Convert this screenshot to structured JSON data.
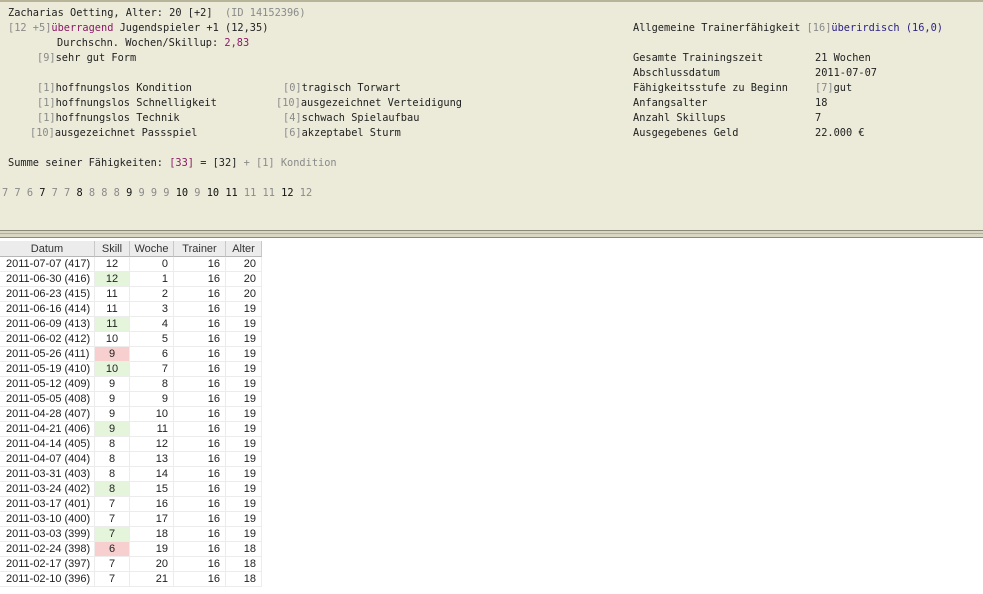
{
  "player": {
    "name_line": "Zacharias Oetting, Alter: 20 [+2]",
    "id_label": "(ID 14152396)",
    "rating_prefix": "[12 +5]",
    "rating_word": "überragend",
    "rating_role": "Jugendspieler +1 (12,35)",
    "avg_label": "Durchschn. Wochen/Skillup:",
    "avg_value": "2,83",
    "form_code": "[9]",
    "form_text": "sehr gut Form"
  },
  "skills": [
    {
      "code": "[1]",
      "text": "hoffnungslos Kondition"
    },
    {
      "code": "[1]",
      "text": "hoffnungslos Schnelligkeit"
    },
    {
      "code": "[1]",
      "text": "hoffnungslos Technik"
    },
    {
      "code": "[10]",
      "text": "ausgezeichnet Passspiel"
    },
    {
      "code": "[0]",
      "text": "tragisch Torwart"
    },
    {
      "code": "[10]",
      "text": "ausgezeichnet Verteidigung"
    },
    {
      "code": "[4]",
      "text": "schwach Spielaufbau"
    },
    {
      "code": "[6]",
      "text": "akzeptabel Sturm"
    }
  ],
  "trainer": {
    "label": "Allgemeine Trainerfähigkeit",
    "code": "[16]",
    "word": "überirdisch",
    "value": "(16,0)"
  },
  "stats": [
    {
      "label": "Gesamte Trainingszeit",
      "value": "21 Wochen"
    },
    {
      "label": "Abschlussdatum",
      "value": "2011-07-07"
    },
    {
      "label": "Fähigkeitsstufe zu Beginn",
      "code": "[7]",
      "value": "gut"
    },
    {
      "label": "Anfangsalter",
      "value": "18"
    },
    {
      "label": "Anzahl Skillups",
      "value": "7"
    },
    {
      "label": "Ausgegebenes Geld",
      "value": "22.000 €"
    }
  ],
  "sum": {
    "label": "Summe seiner Fähigkeiten:",
    "total": "[33]",
    "eq": "=",
    "base": "[32]",
    "plus": "+",
    "extra": "[1] Kondition"
  },
  "progression": [
    {
      "v": "7",
      "dark": false
    },
    {
      "v": "7",
      "dark": false
    },
    {
      "v": "6",
      "dark": false
    },
    {
      "v": "7",
      "dark": true
    },
    {
      "v": "7",
      "dark": false
    },
    {
      "v": "7",
      "dark": false
    },
    {
      "v": "8",
      "dark": true
    },
    {
      "v": "8",
      "dark": false
    },
    {
      "v": "8",
      "dark": false
    },
    {
      "v": "8",
      "dark": false
    },
    {
      "v": "9",
      "dark": true
    },
    {
      "v": "9",
      "dark": false
    },
    {
      "v": "9",
      "dark": false
    },
    {
      "v": "9",
      "dark": false
    },
    {
      "v": "10",
      "dark": true
    },
    {
      "v": "9",
      "dark": false
    },
    {
      "v": "10",
      "dark": true
    },
    {
      "v": "11",
      "dark": true
    },
    {
      "v": "11",
      "dark": false
    },
    {
      "v": "11",
      "dark": false
    },
    {
      "v": "12",
      "dark": true
    },
    {
      "v": "12",
      "dark": false
    }
  ],
  "table": {
    "columns": [
      "Datum",
      "Skill",
      "Woche",
      "Trainer",
      "Alter"
    ],
    "rows": [
      {
        "date": "2011-07-07 (417)",
        "skill": "12",
        "woche": "0",
        "trainer": "16",
        "alter": "20",
        "mark": ""
      },
      {
        "date": "2011-06-30 (416)",
        "skill": "12",
        "woche": "1",
        "trainer": "16",
        "alter": "20",
        "mark": "up"
      },
      {
        "date": "2011-06-23 (415)",
        "skill": "11",
        "woche": "2",
        "trainer": "16",
        "alter": "20",
        "mark": ""
      },
      {
        "date": "2011-06-16 (414)",
        "skill": "11",
        "woche": "3",
        "trainer": "16",
        "alter": "19",
        "mark": ""
      },
      {
        "date": "2011-06-09 (413)",
        "skill": "11",
        "woche": "4",
        "trainer": "16",
        "alter": "19",
        "mark": "up"
      },
      {
        "date": "2011-06-02 (412)",
        "skill": "10",
        "woche": "5",
        "trainer": "16",
        "alter": "19",
        "mark": ""
      },
      {
        "date": "2011-05-26 (411)",
        "skill": "9",
        "woche": "6",
        "trainer": "16",
        "alter": "19",
        "mark": "down"
      },
      {
        "date": "2011-05-19 (410)",
        "skill": "10",
        "woche": "7",
        "trainer": "16",
        "alter": "19",
        "mark": "up"
      },
      {
        "date": "2011-05-12 (409)",
        "skill": "9",
        "woche": "8",
        "trainer": "16",
        "alter": "19",
        "mark": ""
      },
      {
        "date": "2011-05-05 (408)",
        "skill": "9",
        "woche": "9",
        "trainer": "16",
        "alter": "19",
        "mark": ""
      },
      {
        "date": "2011-04-28 (407)",
        "skill": "9",
        "woche": "10",
        "trainer": "16",
        "alter": "19",
        "mark": ""
      },
      {
        "date": "2011-04-21 (406)",
        "skill": "9",
        "woche": "11",
        "trainer": "16",
        "alter": "19",
        "mark": "up"
      },
      {
        "date": "2011-04-14 (405)",
        "skill": "8",
        "woche": "12",
        "trainer": "16",
        "alter": "19",
        "mark": ""
      },
      {
        "date": "2011-04-07 (404)",
        "skill": "8",
        "woche": "13",
        "trainer": "16",
        "alter": "19",
        "mark": ""
      },
      {
        "date": "2011-03-31 (403)",
        "skill": "8",
        "woche": "14",
        "trainer": "16",
        "alter": "19",
        "mark": ""
      },
      {
        "date": "2011-03-24 (402)",
        "skill": "8",
        "woche": "15",
        "trainer": "16",
        "alter": "19",
        "mark": "up"
      },
      {
        "date": "2011-03-17 (401)",
        "skill": "7",
        "woche": "16",
        "trainer": "16",
        "alter": "19",
        "mark": ""
      },
      {
        "date": "2011-03-10 (400)",
        "skill": "7",
        "woche": "17",
        "trainer": "16",
        "alter": "19",
        "mark": ""
      },
      {
        "date": "2011-03-03 (399)",
        "skill": "7",
        "woche": "18",
        "trainer": "16",
        "alter": "19",
        "mark": "up"
      },
      {
        "date": "2011-02-24 (398)",
        "skill": "6",
        "woche": "19",
        "trainer": "16",
        "alter": "18",
        "mark": "down"
      },
      {
        "date": "2011-02-17 (397)",
        "skill": "7",
        "woche": "20",
        "trainer": "16",
        "alter": "18",
        "mark": ""
      },
      {
        "date": "2011-02-10 (396)",
        "skill": "7",
        "woche": "21",
        "trainer": "16",
        "alter": "18",
        "mark": ""
      }
    ]
  }
}
